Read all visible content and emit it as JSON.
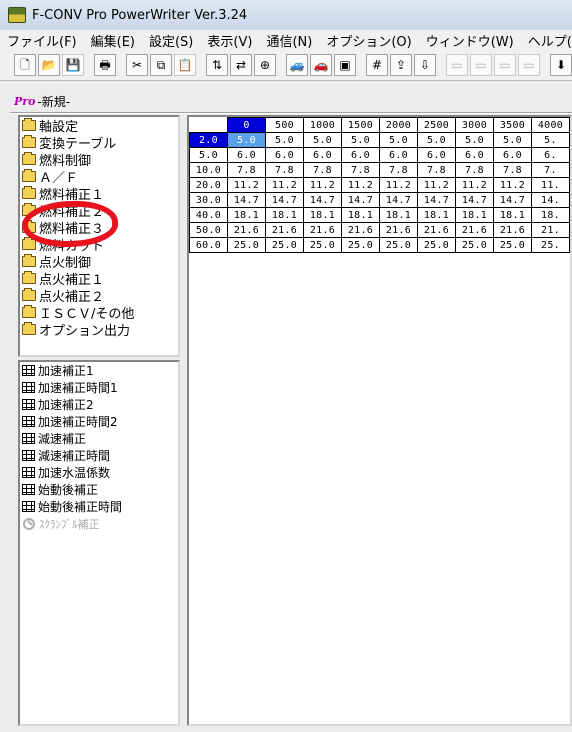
{
  "window": {
    "title": "F-CONV Pro PowerWriter Ver.3.24"
  },
  "menu": [
    "ファイル(F)",
    "編集(E)",
    "設定(S)",
    "表示(V)",
    "通信(N)",
    "オプション(O)",
    "ウィンドウ(W)",
    "ヘルプ(H)"
  ],
  "toolbar": {
    "buttons": [
      {
        "icon": "new-file-icon",
        "glyph": "🗋"
      },
      {
        "icon": "open-folder-icon",
        "glyph": "📂"
      },
      {
        "icon": "save-disk-icon",
        "glyph": "💾",
        "disabled": true
      },
      {
        "icon": "print-icon",
        "glyph": "🖶"
      },
      {
        "icon": "cut-icon",
        "glyph": "✂"
      },
      {
        "icon": "copy-icon",
        "glyph": "⧉"
      },
      {
        "icon": "paste-icon",
        "glyph": "📋",
        "disabled": true
      },
      {
        "icon": "data-transfer-icon",
        "glyph": "⇅"
      },
      {
        "icon": "data-compare-icon",
        "glyph": "⇄"
      },
      {
        "icon": "data-merge-icon",
        "glyph": "⊕"
      },
      {
        "icon": "car-blue-icon",
        "glyph": "🚙"
      },
      {
        "icon": "car-red-icon",
        "glyph": "🚗"
      },
      {
        "icon": "monitor-icon",
        "glyph": "▣"
      },
      {
        "icon": "grid-icon",
        "glyph": "#"
      },
      {
        "icon": "upload-icon",
        "glyph": "⇪"
      },
      {
        "icon": "download-icon",
        "glyph": "⇩"
      },
      {
        "icon": "disabled-1-icon",
        "glyph": "▭",
        "disabled": true
      },
      {
        "icon": "disabled-2-icon",
        "glyph": "▭",
        "disabled": true
      },
      {
        "icon": "disabled-3-icon",
        "glyph": "▭",
        "disabled": true
      },
      {
        "icon": "disabled-4-icon",
        "glyph": "▭",
        "disabled": true
      },
      {
        "icon": "green-arrow-down-icon",
        "glyph": "⬇"
      }
    ]
  },
  "document": {
    "title": "-新規-",
    "icon_text": "Pro"
  },
  "tree": {
    "items": [
      "軸設定",
      "変換テーブル",
      "燃料制御",
      "Ａ／Ｆ",
      "燃料補正１",
      "燃料補正２",
      "燃料補正３",
      "燃料カット",
      "点火制御",
      "点火補正１",
      "点火補正２",
      "ＩＳＣＶ/その他",
      "オプション出力"
    ]
  },
  "list": {
    "items": [
      {
        "label": "加速補正1",
        "enabled": true
      },
      {
        "label": "加速補正時間1",
        "enabled": true
      },
      {
        "label": "加速補正2",
        "enabled": true
      },
      {
        "label": "加速補正時間2",
        "enabled": true
      },
      {
        "label": "減速補正",
        "enabled": true
      },
      {
        "label": "減速補正時間",
        "enabled": true
      },
      {
        "label": "加速水温係数",
        "enabled": true
      },
      {
        "label": "始動後補正",
        "enabled": true
      },
      {
        "label": "始動後補正時間",
        "enabled": true
      },
      {
        "label": "ｽｸﾗﾝﾌﾞﾙ補正",
        "enabled": false
      }
    ]
  },
  "map_table": {
    "columns": [
      "0",
      "500",
      "1000",
      "1500",
      "2000",
      "2500",
      "3000",
      "3500",
      "4000"
    ],
    "rows": [
      {
        "label": "2.0",
        "values": [
          "5.0",
          "5.0",
          "5.0",
          "5.0",
          "5.0",
          "5.0",
          "5.0",
          "5.0",
          "5."
        ]
      },
      {
        "label": "5.0",
        "values": [
          "6.0",
          "6.0",
          "6.0",
          "6.0",
          "6.0",
          "6.0",
          "6.0",
          "6.0",
          "6."
        ]
      },
      {
        "label": "10.0",
        "values": [
          "7.8",
          "7.8",
          "7.8",
          "7.8",
          "7.8",
          "7.8",
          "7.8",
          "7.8",
          "7."
        ]
      },
      {
        "label": "20.0",
        "values": [
          "11.2",
          "11.2",
          "11.2",
          "11.2",
          "11.2",
          "11.2",
          "11.2",
          "11.2",
          "11."
        ]
      },
      {
        "label": "30.0",
        "values": [
          "14.7",
          "14.7",
          "14.7",
          "14.7",
          "14.7",
          "14.7",
          "14.7",
          "14.7",
          "14."
        ]
      },
      {
        "label": "40.0",
        "values": [
          "18.1",
          "18.1",
          "18.1",
          "18.1",
          "18.1",
          "18.1",
          "18.1",
          "18.1",
          "18."
        ]
      },
      {
        "label": "50.0",
        "values": [
          "21.6",
          "21.6",
          "21.6",
          "21.6",
          "21.6",
          "21.6",
          "21.6",
          "21.6",
          "21."
        ]
      },
      {
        "label": "60.0",
        "values": [
          "25.0",
          "25.0",
          "25.0",
          "25.0",
          "25.0",
          "25.0",
          "25.0",
          "25.0",
          "25."
        ]
      }
    ],
    "selected": {
      "row": 0,
      "col": 0
    }
  },
  "colors": {
    "selection_header": "#0000d8",
    "selection_cell": "#5aa0e8",
    "annotation_red": "#e8121f"
  }
}
